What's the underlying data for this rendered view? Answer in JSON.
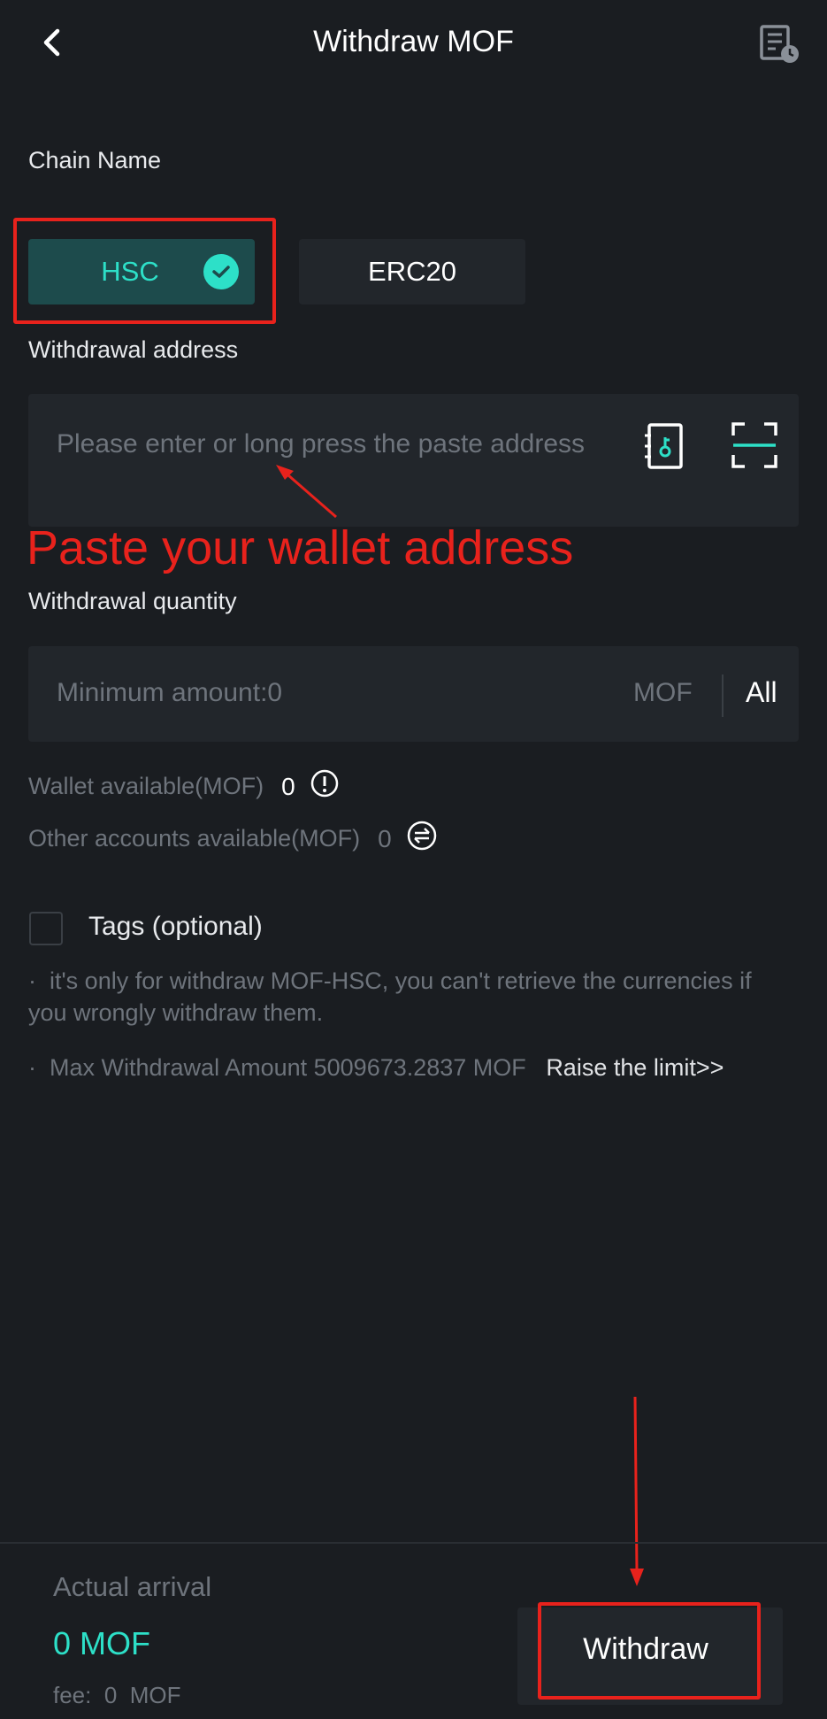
{
  "header": {
    "title": "Withdraw MOF",
    "back_icon": "chevron-left-icon",
    "record_icon": "history-record-icon"
  },
  "chain": {
    "label": "Chain Name",
    "options": [
      "HSC",
      "ERC20"
    ],
    "selected": "HSC"
  },
  "address": {
    "label": "Withdrawal address",
    "placeholder": "Please enter or long press the paste address",
    "icons": [
      "address-book-icon",
      "scan-icon"
    ]
  },
  "annotation": {
    "text": "Paste your wallet address"
  },
  "quantity": {
    "label": "Withdrawal quantity",
    "placeholder": "Minimum amount:0",
    "unit": "MOF",
    "all_label": "All"
  },
  "balances": {
    "wallet_label": "Wallet available(MOF)",
    "wallet_value": "0",
    "other_label": "Other accounts available(MOF)",
    "other_value": "0"
  },
  "tags": {
    "label": "Tags (optional)"
  },
  "notes": {
    "note1_bullet": "·",
    "note1": "it's only for withdraw MOF-HSC, you can't retrieve the currencies if you wrongly withdraw them.",
    "note2_bullet": "·",
    "note2": "Max Withdrawal Amount 5009673.2837 MOF",
    "note2_link": "Raise the limit>>"
  },
  "bottom": {
    "arrival_label": "Actual arrival",
    "arrival_value": "0 MOF",
    "fee_label": "fee:",
    "fee_value": "0",
    "fee_unit": "MOF",
    "withdraw_label": "Withdraw"
  },
  "colors": {
    "background": "#1a1d21",
    "accent": "#2de0c8",
    "annotation_red": "#e8221c"
  }
}
